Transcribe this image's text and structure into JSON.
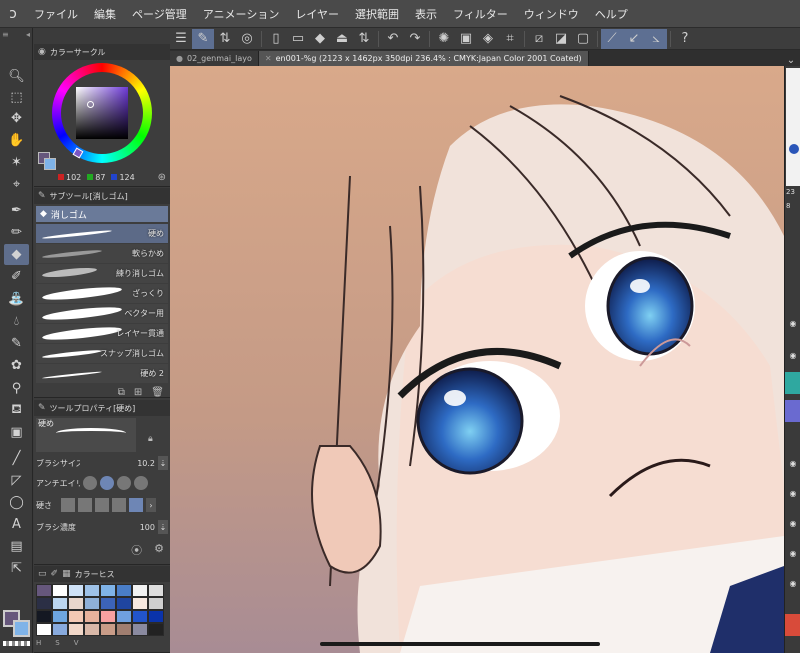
{
  "menubar": {
    "items": [
      "ファイル",
      "編集",
      "ページ管理",
      "アニメーション",
      "レイヤー",
      "選択範囲",
      "表示",
      "フィルター",
      "ウィンドウ",
      "ヘルプ"
    ]
  },
  "tabs": [
    {
      "label": "02_genmai_layo",
      "active": false
    },
    {
      "label": "en001-%g (2123 x 1462px 350dpi 236.4% : CMYK:Japan Color 2001 Coated)",
      "active": true
    }
  ],
  "panels": {
    "color_wheel": {
      "title": "カラーサークル",
      "r": "102",
      "g": "87",
      "b": "124",
      "main_color": "#66577c",
      "sub_color": "#7fb3e8"
    },
    "subtool": {
      "title": "サブツール[消しゴム]",
      "group": "消しゴム",
      "brushes": [
        {
          "label": "硬め",
          "active": true
        },
        {
          "label": "軟らかめ",
          "active": false
        },
        {
          "label": "練り消しゴム",
          "active": false
        },
        {
          "label": "ざっくり",
          "active": false
        },
        {
          "label": "ベクター用",
          "active": false
        },
        {
          "label": "レイヤー貫通",
          "active": false
        },
        {
          "label": "スナップ消しゴム",
          "active": false
        },
        {
          "label": "硬め 2",
          "active": false
        }
      ]
    },
    "tool_property": {
      "title": "ツールプロパティ[硬め]",
      "preview_label": "硬め",
      "brush_size_label": "ブラシサイズ",
      "brush_size_value": "10.2",
      "antialias_label": "アンチエイリ",
      "hardness_label": "硬さ",
      "density_label": "ブラシ濃度",
      "density_value": "100"
    },
    "color_history": {
      "title": "カラーヒス",
      "foot": [
        "H",
        "S",
        "V"
      ]
    }
  },
  "right_strip": {
    "nums": [
      "23",
      "8"
    ]
  },
  "colors": {
    "accent": "#5f6e8c",
    "layer_teal": "#2fa8a0",
    "layer_purple": "#6a6ad0",
    "layer_red": "#d84b3a"
  },
  "icons": {
    "toolbar": [
      "menu-icon",
      "edit-icon",
      "swap-icon",
      "target-icon",
      "new-icon",
      "open-icon",
      "fill-icon",
      "erase-icon",
      "undo-icon",
      "redo-icon",
      "loading-icon",
      "transform-icon",
      "fill-area-icon",
      "select-icon",
      "snap-icon",
      "ruler-icon",
      "help-icon"
    ]
  }
}
